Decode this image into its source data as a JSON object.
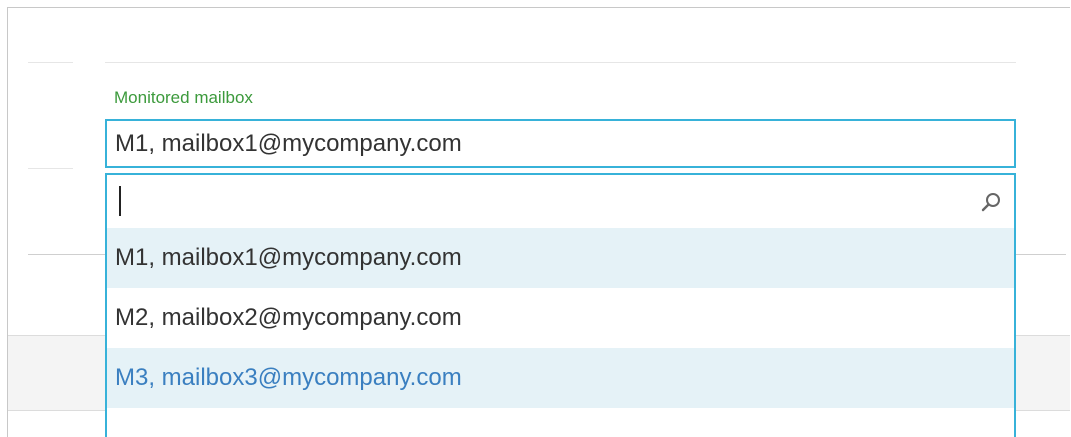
{
  "field": {
    "label": "Monitored mailbox",
    "selected_value": "M1, mailbox1@mycompany.com"
  },
  "search": {
    "value": "",
    "placeholder": "",
    "icon": "search-icon"
  },
  "options": [
    {
      "label": "M1, mailbox1@mycompany.com",
      "state": "selected"
    },
    {
      "label": "M2, mailbox2@mycompany.com",
      "state": "normal"
    },
    {
      "label": "M3, mailbox3@mycompany.com",
      "state": "hover"
    }
  ],
  "colors": {
    "label_green": "#3c9a3c",
    "focus_border": "#37b2d9",
    "selected_bg": "#e5f2f7",
    "hover_text": "#3a7fc0"
  }
}
